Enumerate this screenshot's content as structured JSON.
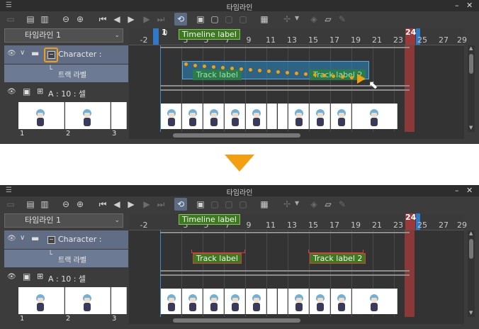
{
  "window": {
    "title": "타임라인",
    "minimize_glyph": "–",
    "close_glyph": "✕",
    "menu_icon": "hamburger-icon"
  },
  "accent": {
    "orange": "#f2a012",
    "blue_marker": "#2f79c8",
    "red_marker": "#9b3a3a",
    "label_green": "#3d7a1f"
  },
  "toolbar": {
    "icons": [
      "new-timeline-icon",
      "film-icon",
      "film-edit-icon",
      "zoom-out-icon",
      "zoom-in-icon",
      "first-frame-icon",
      "prev-frame-icon",
      "play-icon",
      "next-frame-icon",
      "last-frame-icon",
      "loop-icon",
      "new-animation-cel-icon",
      "cel-spec-icon",
      "onion-skin-icon",
      "edit-icon",
      "lightbox-icon",
      "camera-move-icon",
      "dropdown-icon",
      "keyframe-icon",
      "folder-effect-icon",
      "pen-icon"
    ]
  },
  "timeline_select": {
    "value": "타임라인 1"
  },
  "ruler": {
    "ticks": [
      "-2",
      "0",
      "1",
      "3",
      "5",
      "7",
      "9",
      "11",
      "13",
      "15",
      "17",
      "19",
      "21",
      "23",
      "24",
      "25",
      "27",
      "29"
    ],
    "top_ticks": [
      "-2",
      "0",
      "1",
      "3",
      "5",
      "7",
      "9",
      "11",
      "13",
      "15",
      "17",
      "19",
      "21",
      "23",
      "24",
      "25",
      "27",
      "29"
    ],
    "current_frame": "24",
    "start_frame": "1"
  },
  "timeline_label": "Timeline label",
  "layers": {
    "folder": {
      "name": "Character :",
      "track_label_row": "트랙 라벨"
    },
    "animation_folder": {
      "name": "A : 10 : 셀"
    },
    "thumbnails_numbers": [
      "1",
      "2",
      "3"
    ]
  },
  "track_labels": {
    "before": [
      "Track label",
      "Track label 2"
    ],
    "after": [
      "Track label",
      "Track label 2"
    ]
  },
  "indicator": {
    "arrow_color": "#f2a012"
  }
}
